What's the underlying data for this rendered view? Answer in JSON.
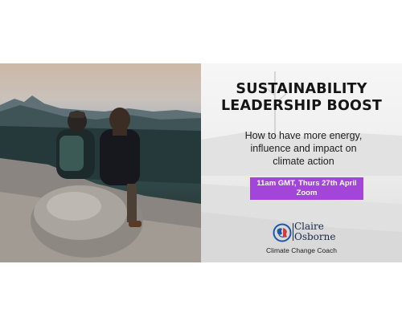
{
  "banner": {
    "title_line1": "SUSTAINABILITY",
    "title_line2": "LEADERSHIP BOOST",
    "subtitle_line1": "How to have more energy,",
    "subtitle_line2": "influence and impact on",
    "subtitle_line3": "climate action",
    "event_time": "11am GMT, Thurs 27th April",
    "event_location": "Zoom",
    "logo_name_line1": "Claire",
    "logo_name_line2": "Osborne",
    "tagline": "Climate Change Coach"
  },
  "colors": {
    "accent": "#a445d9",
    "logo_blue": "#1f57a8",
    "logo_red": "#d23a3a"
  }
}
